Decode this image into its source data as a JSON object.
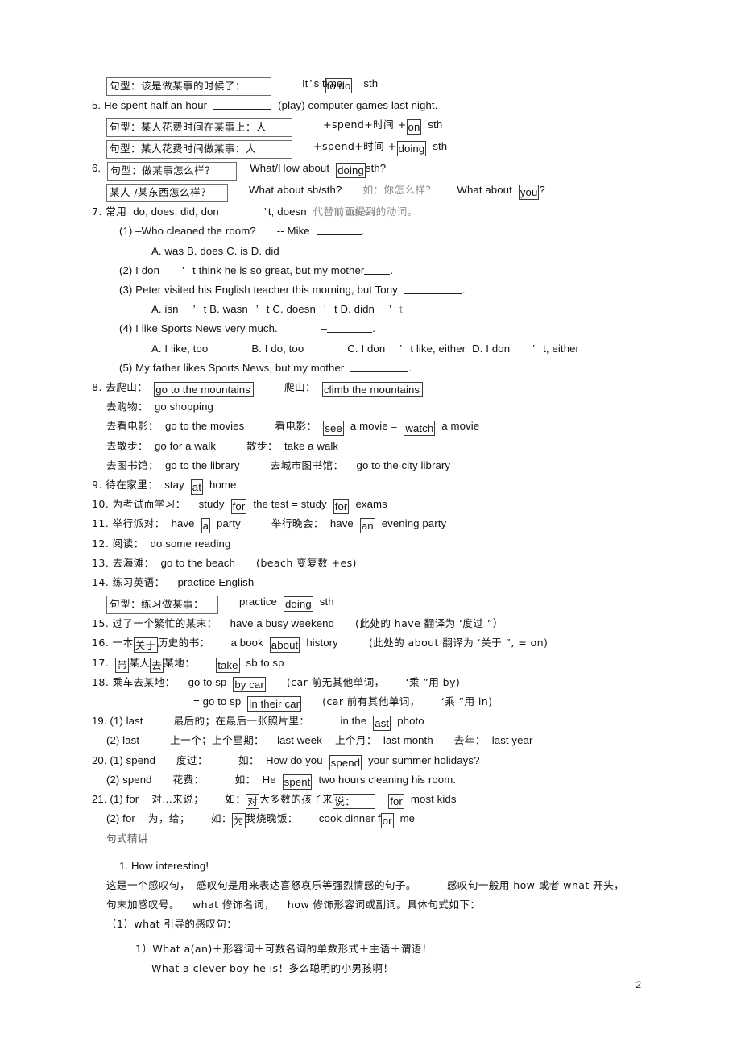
{
  "page": {
    "number": "2",
    "background": "#ffffff",
    "text_color": "#111111"
  },
  "lines": {
    "l1_box": "句型：该是做某事的时候了：",
    "l1_a": "It",
    "l1_apos": "’",
    "l1_b": "s time",
    "l1_box2": "to do",
    "l1_c": "sth",
    "l5_num": "5. He spent half an hour",
    "l5_tail": "(play) computer games last night.",
    "l5_box1": "句型：某人花费时间在某事上：人",
    "l5_formula1": "+spend+时间 +",
    "l5_on": "on",
    "l5_sth1": "sth",
    "l5_box2": "句型：某人花费时间做某事：人",
    "l5_formula2": "+spend+时间 +",
    "l5_doing": "doing",
    "l5_sth2": "sth",
    "l6_num": "6.",
    "l6_box1": "句型：做某事怎么样？",
    "l6_a": "What/How about",
    "l6_doing": "doing",
    "l6_sth": "sth?",
    "l6_box2": "某人 /某东西怎么样？",
    "l6_b": "What about sb/sth?",
    "l6_c": "如：你怎么样？",
    "l6_d": "What about",
    "l6_you": "you",
    "l6_q": "?",
    "l7_num": "7. 常用",
    "l7_a": "do, does, did, don",
    "l7_apos": "’",
    "l7_b": "t, doesn",
    "l7_cn_under": "代替前面提到的动词。",
    "l7_cn_over": "’t, doesn",
    "l7_1": "(1)  –Who cleaned the room?",
    "l7_1b": "-- Mike",
    "l7_1_opts": "A. was      B. does      C. is      D. did",
    "l7_2a": "(2) I don",
    "l7_2apos": "’",
    "l7_2b": "t think he is so great, but my mother",
    "l7_2c": ".",
    "l7_3": "(3) Peter visited his English teacher this morning, but Tony",
    "l7_3b": ".",
    "l7_3_opts_a": "A. isn",
    "l7_3_opts_b": "t B. wasn",
    "l7_3_opts_c": "t C. doesn",
    "l7_3_opts_d": "t D. didn",
    "l7_3_opts_e": "t",
    "l7_4": "(4) I like Sports News very much.",
    "l7_4dash": "–",
    "l7_4b": ".",
    "l7_4_opt_a": "A. I like, too",
    "l7_4_opt_b": "B. I do, too",
    "l7_4_opt_c1": "C. I don",
    "l7_4_opt_c2": "t like, either",
    "l7_4_opt_d1": "D. I don",
    "l7_4_opt_d2": "t, either",
    "l7_5": "(5) My father likes Sports News, but my mother",
    "l7_5b": ".",
    "l8_num": "8. 去爬山：",
    "l8_a": "go to the mountains",
    "l8_b": "爬山：",
    "l8_c": "climb the mountains",
    "l8_shop_cn": "去购物：",
    "l8_shop_en": "go shopping",
    "l8_movie_cn": "去看电影：",
    "l8_movie_en": "go to the movies",
    "l8_movie2_cn": "看电影：",
    "l8_see": "see",
    "l8_movie2_en": "a movie =",
    "l8_watch": "watch",
    "l8_movie3_en": "a movie",
    "l8_walk_cn": "去散步：",
    "l8_walk_en": "go for a walk",
    "l8_walk2_cn": "散步：",
    "l8_walk2_en": "take a walk",
    "l8_lib_cn": "去图书馆：",
    "l8_lib_en": "go to the library",
    "l8_lib2_cn": "去城市图书馆：",
    "l8_lib2_en": "go to the city library",
    "l9_num": "9. 待在家里：",
    "l9_a": "stay",
    "l9_at": "at",
    "l9_b": "home",
    "l10_num": "10. 为考试而学习：",
    "l10_a": "study",
    "l10_for1": "for",
    "l10_b": "the test = study",
    "l10_for2": "for",
    "l10_c": "exams",
    "l11_num": "11. 举行派对：",
    "l11_a": "have",
    "l11_art1": "a",
    "l11_b": "party",
    "l11_c": "举行晚会：",
    "l11_d": "have",
    "l11_art2": "an",
    "l11_e": "evening party",
    "l12_num": "12. 阅读：",
    "l12_a": "do some reading",
    "l13_num": "13. 去海滩：",
    "l13_a": "go to the beach",
    "l13_b": "(beach 变复数 +es)",
    "l14_num": "14. 练习英语：",
    "l14_a": "practice English",
    "l14_box": "句型：练习做某事：",
    "l14_b": "practice",
    "l14_doing": "doing",
    "l14_c": "sth",
    "l15_num": "15. 过了一个繁忙的某末：",
    "l15_a": "have a busy weekend",
    "l15_b": "(此处的 have 翻译为 ‘度过 ”）",
    "l16_num": "16. 一本",
    "l16_box1": "关于",
    "l16_num_b": "历史的书：",
    "l16_a": "a book",
    "l16_about": "about",
    "l16_b": "history",
    "l16_c": "(此处的 about 翻译为 ‘关于 ”, = on)",
    "l17_num": "17.",
    "l17_box1": "带",
    "l17_mid": "某人",
    "l17_box2": "去",
    "l17_end": "某地：",
    "l17_take": "take",
    "l17_a": "sb to sp",
    "l18_num": "18. 乘车去某地：",
    "l18_a": "go to sp",
    "l18_bycar": "by car",
    "l18_b": "(car 前无其他单词，",
    "l18_c": "‘乘 ”用 by)",
    "l18_d": "= go to sp",
    "l18_intheircar": "in their car",
    "l18_e": "(car 前有其他单词，",
    "l18_f": "‘乘 ”用 in)",
    "l19_num": "19. (1) last",
    "l19_a": "最后的；在最后一张照片里：",
    "l19_b": "in the",
    "l19_last": "ast",
    "l19_c": "photo",
    "l19_2num": "(2) last",
    "l19_2a": "上一个；上个星期：",
    "l19_2b": "last week",
    "l19_2c": "上个月：",
    "l19_2d": "last month",
    "l19_2e": "去年：",
    "l19_2f": "last year",
    "l20_num": "20. (1) spend",
    "l20_a": "度过：",
    "l20_b": "如：",
    "l20_c": "How do you",
    "l20_spend": "spend",
    "l20_d": "your summer holidays?",
    "l20_2num": "(2) spend",
    "l20_2a": "花费：",
    "l20_2b": "如：",
    "l20_2c": "He",
    "l20_spent": "spent",
    "l20_2d": "two hours cleaning his room.",
    "l21_num": "21. (1) for",
    "l21_a": "对…来说；",
    "l21_b": "如：",
    "l21_cn1": "对",
    "l21_cn2": "大多数的孩子来",
    "l21_cn3": "说：",
    "l21_for": "for",
    "l21_c": "most kids",
    "l21_2num": "(2) for",
    "l21_2a": "为，给；",
    "l21_2b": "如：",
    "l21_2cn1": "为",
    "l21_2cn2": "我",
    "l21_2cn3": "烧晚饭：",
    "l21_2c": "cook dinner f",
    "l21_2for": "or",
    "l21_2d": "me",
    "section_title": "句式精讲",
    "s1_title": "1. How interesting!",
    "s1_p1a": "这是一个感叹句，",
    "s1_p1b": "感叹句是用来表达喜怒哀乐等强烈情感的句子。",
    "s1_p1c": "感叹句一般用  how 或者 what 开头，",
    "s1_p2a": "句末加感叹号。",
    "s1_p2b": "what 修饰名词，",
    "s1_p2c": "how 修饰形容词或副词。具体句式如下：",
    "s1_p3": "（1）what 引导的感叹句：",
    "s1_p4": "1）What a(an)＋形容词＋可数名词的单数形式＋主语＋谓语！",
    "s1_p5": "What a clever boy he is！多么聪明的小男孩啊！"
  }
}
